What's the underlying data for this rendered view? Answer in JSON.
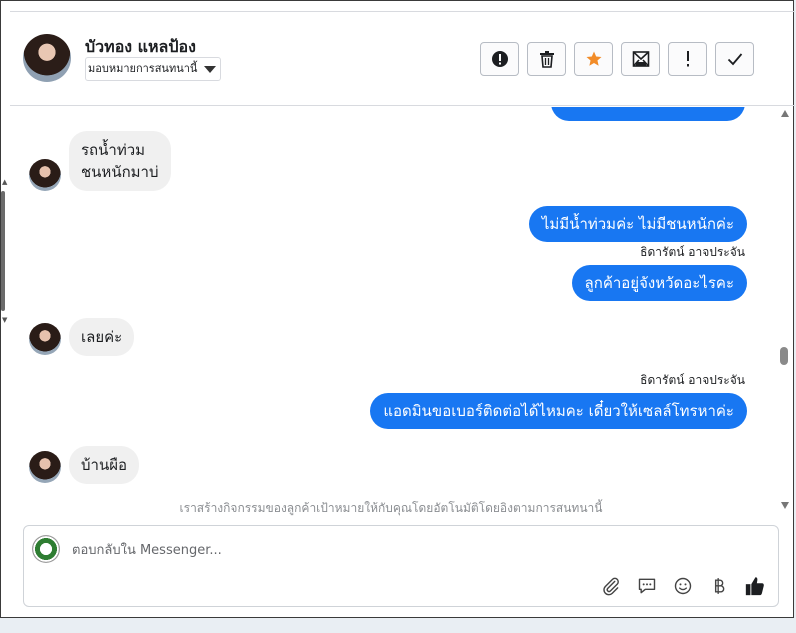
{
  "contact": {
    "name": "บัวทอง แหลป้อง",
    "assign_label": "มอบหมายการสนทนานี้"
  },
  "toolbar": {
    "buttons": [
      {
        "icon": "alert-circle-icon"
      },
      {
        "icon": "trash-icon"
      },
      {
        "icon": "star-icon",
        "color": "#f28c28"
      },
      {
        "icon": "mark-unread-icon"
      },
      {
        "icon": "important-icon"
      },
      {
        "icon": "done-check-icon"
      }
    ]
  },
  "messages": [
    {
      "dir": "in",
      "lines": [
        "รถน้ำท่วม",
        "ชนหนักมาบ่"
      ]
    },
    {
      "dir": "out",
      "text": "ไม่มีน้ำท่วมค่ะ ไม่มีชนหนักค่ะ"
    },
    {
      "dir": "out",
      "sender": "ธิดารัตน์ อาจประจัน",
      "text": "ลูกค้าอยู่จังหวัดอะไรคะ"
    },
    {
      "dir": "in",
      "text": "เลยค่ะ"
    },
    {
      "dir": "out",
      "sender": "ธิดารัตน์ อาจประจัน",
      "text": "แอดมินขอเบอร์ติดต่อได้ไหมคะ เดี๋ยวให้เซลล์โทรหาค่ะ"
    },
    {
      "dir": "in",
      "text": "บ้านผือ"
    }
  ],
  "notice": "เราสร้างกิจกรรมของลูกค้าเป้าหมายให้กับคุณโดยอัตโนมัติโดยอิงตามการสนทนานี้",
  "composer": {
    "placeholder": "ตอบกลับใน Messenger...",
    "tools": [
      "paperclip-icon",
      "chat-bubble-icon",
      "smiley-icon",
      "baht-icon",
      "thumbs-up-icon"
    ]
  },
  "colors": {
    "outgoing_bubble": "#1877f2",
    "incoming_bubble": "#f0f0f0"
  }
}
